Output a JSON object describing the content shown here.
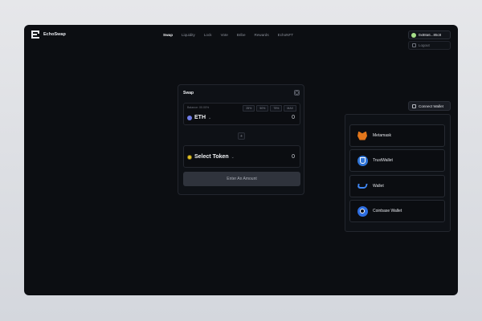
{
  "header": {
    "app_name": "EchoSwap",
    "nav": [
      "Swap",
      "Liquidity",
      "Lock",
      "Vote",
      "Bribe",
      "Rewards",
      "EchoNFT"
    ],
    "active_nav": "Swap",
    "wallet_address": "0x88a6...85c8",
    "logout_label": "Logout"
  },
  "swap": {
    "title": "Swap",
    "from": {
      "balance": "Balance: 00.00%",
      "percent_buttons": [
        "25%",
        "50%",
        "75%",
        "MAX"
      ],
      "token": "ETH",
      "amount": "0"
    },
    "to": {
      "token": "Select Token",
      "amount": "0"
    },
    "switch_symbol": "+",
    "submit_label": "Enter An Amount"
  },
  "connect": {
    "button_label": "Connect Wallet",
    "wallets": [
      "Metamask",
      "TrustWallet",
      "Wallet",
      "Coinbase Wallet"
    ]
  },
  "colors": {
    "background": "#0c0e12",
    "surface": "#0e1116",
    "border": "#23262e",
    "eth": "#6f7ce8",
    "select_token": "#e6c324",
    "button": "#2f333c"
  }
}
